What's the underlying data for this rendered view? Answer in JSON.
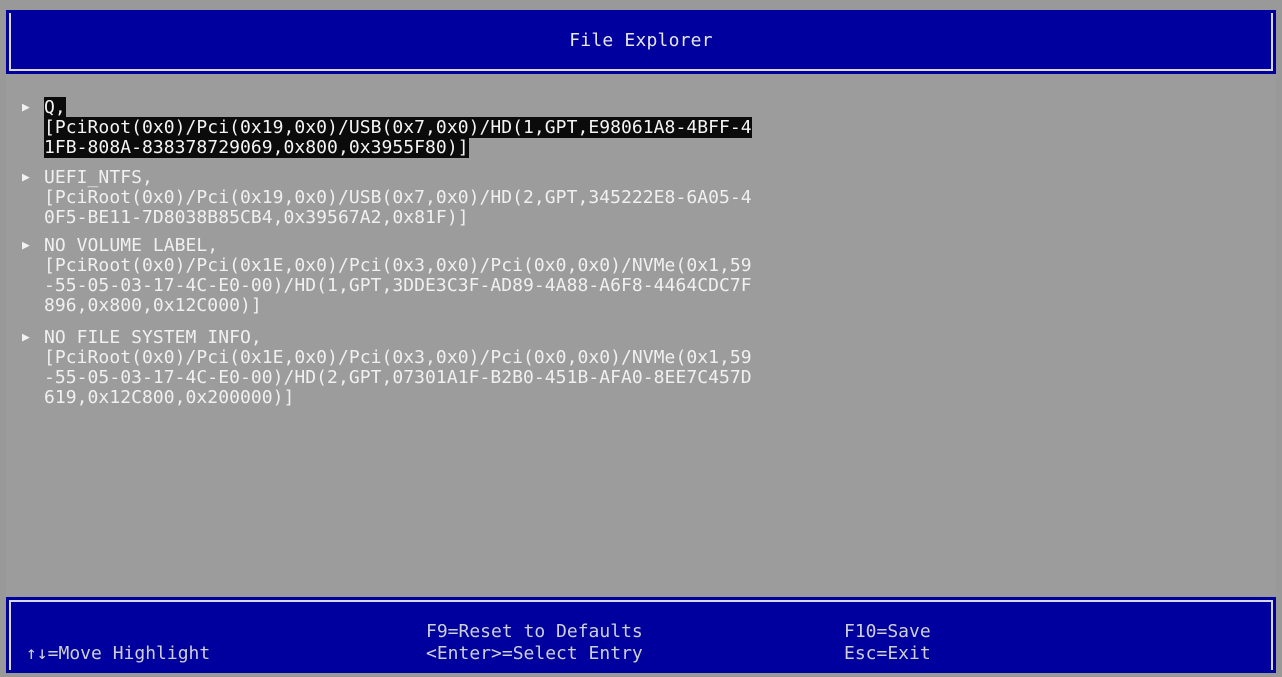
{
  "title": "File Explorer",
  "entries": [
    {
      "lines": [
        "Q,",
        "[PciRoot(0x0)/Pci(0x19,0x0)/USB(0x7,0x0)/HD(1,GPT,E98061A8-4BFF-4",
        "1FB-808A-838378729069,0x800,0x3955F80)]"
      ],
      "selected": true
    },
    {
      "lines": [
        "UEFI_NTFS,",
        "[PciRoot(0x0)/Pci(0x19,0x0)/USB(0x7,0x0)/HD(2,GPT,345222E8-6A05-4",
        "0F5-BE11-7D8038B85CB4,0x39567A2,0x81F)]"
      ],
      "selected": false
    },
    {
      "lines": [
        "NO VOLUME LABEL,",
        "[PciRoot(0x0)/Pci(0x1E,0x0)/Pci(0x3,0x0)/Pci(0x0,0x0)/NVMe(0x1,59",
        "-55-05-03-17-4C-E0-00)/HD(1,GPT,3DDE3C3F-AD89-4A88-A6F8-4464CDC7F",
        "896,0x800,0x12C000)]"
      ],
      "selected": false
    },
    {
      "lines": [
        "NO FILE SYSTEM INFO,",
        "[PciRoot(0x0)/Pci(0x1E,0x0)/Pci(0x3,0x0)/Pci(0x0,0x0)/NVMe(0x1,59",
        "-55-05-03-17-4C-E0-00)/HD(2,GPT,07301A1F-B2B0-451B-AFA0-8EE7C457D",
        "619,0x12C800,0x200000)]"
      ],
      "selected": false
    }
  ],
  "footer": {
    "move_highlight": "↑↓=Move Highlight",
    "reset_defaults": "F9=Reset to Defaults",
    "select_entry": "<Enter>=Select Entry",
    "save": "F10=Save",
    "exit": "Esc=Exit"
  },
  "colors": {
    "title_bg": "#00009f",
    "content_bg": "#9c9c9c",
    "highlight_bg": "#0b0b0b",
    "text": "#f0f0f0"
  },
  "icons": {
    "entry_arrow": "right-triangle-icon"
  }
}
